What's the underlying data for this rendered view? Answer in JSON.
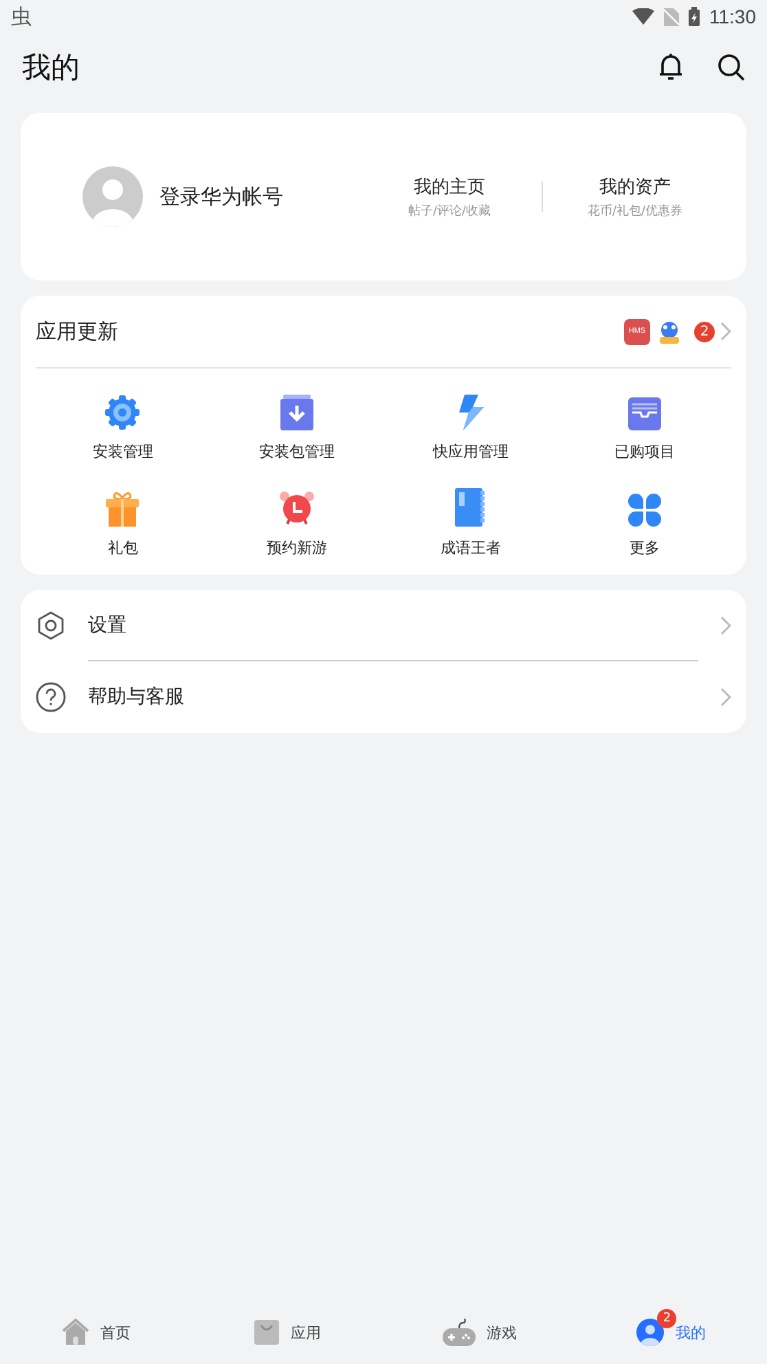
{
  "status_bar": {
    "app_glyph": "虫",
    "time": "11:30"
  },
  "header": {
    "title": "我的"
  },
  "profile": {
    "login": "登录华为帐号",
    "links": [
      {
        "title": "我的主页",
        "subtitle": "帖子/评论/收藏"
      },
      {
        "title": "我的资产",
        "subtitle": "花币/礼包/优惠券"
      }
    ]
  },
  "updates": {
    "title": "应用更新",
    "app_icon_label": "HMS",
    "count": "2"
  },
  "tools": [
    {
      "kind": "gear",
      "label": "安装管理"
    },
    {
      "kind": "package",
      "label": "安装包管理"
    },
    {
      "kind": "bolt",
      "label": "快应用管理"
    },
    {
      "kind": "tray",
      "label": "已购项目"
    },
    {
      "kind": "gift",
      "label": "礼包"
    },
    {
      "kind": "alarm",
      "label": "预约新游"
    },
    {
      "kind": "book",
      "label": "成语王者"
    },
    {
      "kind": "more",
      "label": "更多"
    }
  ],
  "menu": [
    {
      "kind": "settings",
      "label": "设置"
    },
    {
      "kind": "help",
      "label": "帮助与客服"
    }
  ],
  "nav": [
    {
      "kind": "home",
      "label": "首页",
      "selected": false
    },
    {
      "kind": "apps",
      "label": "应用",
      "selected": false
    },
    {
      "kind": "games",
      "label": "游戏",
      "selected": false
    },
    {
      "kind": "me",
      "label": "我的",
      "selected": true,
      "badge": "2"
    }
  ]
}
